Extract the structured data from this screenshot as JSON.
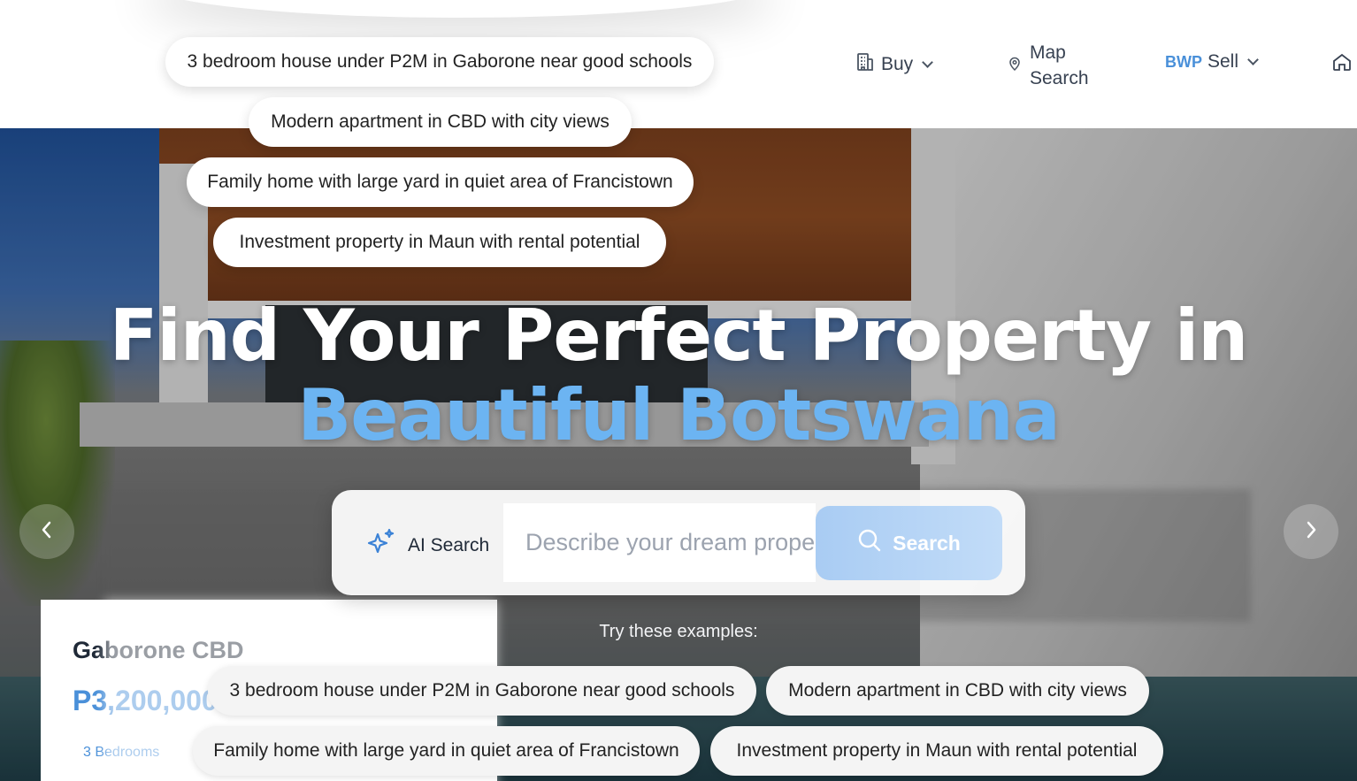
{
  "nav": {
    "buy_label": "Buy",
    "map_label": "Map Search",
    "currency": "BWP",
    "sell_label": "Sell",
    "icons": {
      "buy": "building-icon",
      "map": "map-pin-icon",
      "home": "home-icon"
    }
  },
  "floating_suggestions": [
    "3 bedroom house under P2M in Gaborone near good schools",
    "Modern apartment in CBD with city views",
    "Family home with large yard in quiet area of Francistown",
    "Investment property in Maun with rental potential"
  ],
  "hero": {
    "title_line1": "Find Your Perfect Property in",
    "title_line2": "Beautiful Botswana"
  },
  "search": {
    "ai_label": "AI Search",
    "placeholder": "Describe your dream property...",
    "button_label": "Search"
  },
  "examples": {
    "label": "Try these examples:",
    "items": [
      "3 bedroom house under P2M in Gaborone near good schools",
      "Modern apartment in CBD with city views",
      "Family home with large yard in quiet area of Francistown",
      "Investment property in Maun with rental potential"
    ]
  },
  "featured_card": {
    "title": "Gaborone CBD",
    "price": "P3,200,000",
    "beds": "3 Bedrooms"
  },
  "colors": {
    "accent": "#6cb4f2",
    "brand_blue": "#4a90d9",
    "search_button": "#b3d3f5"
  }
}
